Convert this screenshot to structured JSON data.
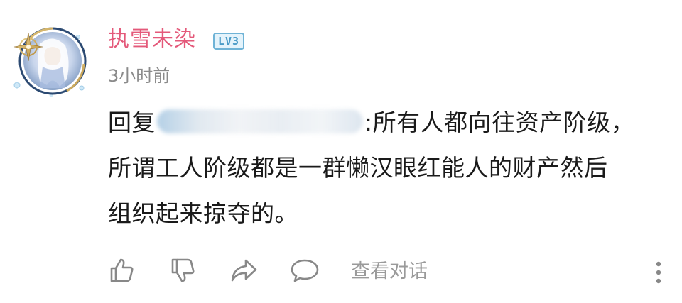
{
  "comment": {
    "username": "执雪未染",
    "level_badge": "LV3",
    "timestamp": "3小时前",
    "reply_prefix": "回复",
    "reply_text_line1": ":所有人都向往资产阶级，",
    "reply_text_line2": "所谓工人阶级都是一群懒汉眼红能人的财产然后",
    "reply_text_line3": "组织起来掠夺的。"
  },
  "actions": {
    "like_icon": "thumbs-up-icon",
    "dislike_icon": "thumbs-down-icon",
    "share_icon": "share-arrow-icon",
    "reply_icon": "speech-bubble-icon",
    "view_dialog_label": "查看对话",
    "more_icon": "vertical-ellipsis-icon"
  },
  "colors": {
    "username": "#e4597a",
    "badge": "#4a9bc7",
    "muted": "#8a8a8a",
    "icon": "#888888"
  }
}
